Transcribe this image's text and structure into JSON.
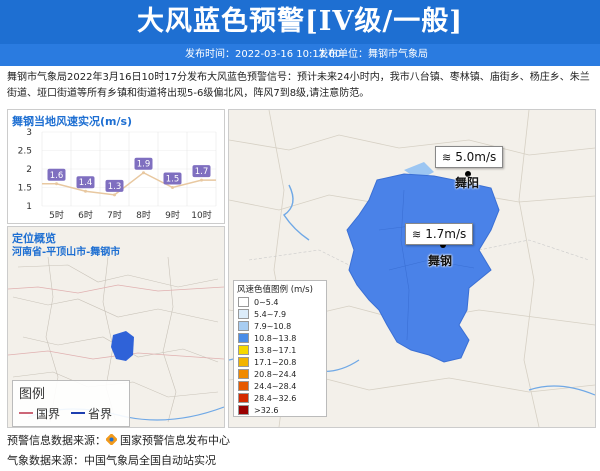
{
  "header": {
    "title": "大风蓝色预警[IV级/一般]",
    "publish_time": "发布时间：2022-03-16 10:17:00",
    "publish_unit": "发布单位：舞钢市气象局"
  },
  "description": "舞钢市气象局2022年3月16日10时17分发布大风蓝色预警信号：预计未来24小时内，我市八台镇、枣林镇、庙街乡、杨庄乡、朱兰街道、垭口街道等所有乡镇和街道将出现5-6级偏北风，阵风7到8级,请注意防范。",
  "wind_panel": {
    "title": "舞钢当地风速实况(m/s)",
    "chart_data": {
      "type": "line",
      "categories": [
        "5时",
        "6时",
        "7时",
        "8时",
        "9时",
        "10时"
      ],
      "values": [
        1.6,
        1.4,
        1.3,
        1.9,
        1.5,
        1.7
      ],
      "ylim": [
        1,
        3
      ],
      "yticks": [
        "3",
        "2.5",
        "2",
        "1.5",
        "1"
      ],
      "color": "#7f6fc0"
    }
  },
  "location_panel": {
    "title": "定位概览",
    "subtitle": "河南省-平顶山市-舞钢市",
    "legend": {
      "title": "图例",
      "items": [
        {
          "label": "国界",
          "color": "#cc6677"
        },
        {
          "label": "省界",
          "color": "#1e3fb0"
        }
      ]
    }
  },
  "main_map": {
    "wind_tags": [
      {
        "label": "5.0m/s",
        "icon": "wind-icon"
      },
      {
        "label": "1.7m/s",
        "icon": "wind-icon"
      }
    ],
    "cities": [
      "舞阳",
      "舞钢"
    ],
    "scale": {
      "title": "风速色值图例 (m/s)",
      "items": [
        {
          "label": "0~5.4",
          "color": "#ffffff"
        },
        {
          "label": "5.4~7.9",
          "color": "#dcecfa"
        },
        {
          "label": "7.9~10.8",
          "color": "#a8cdf2"
        },
        {
          "label": "10.8~13.8",
          "color": "#4a8de8"
        },
        {
          "label": "13.8~17.1",
          "color": "#f5d800"
        },
        {
          "label": "17.1~20.8",
          "color": "#f2b400"
        },
        {
          "label": "20.8~24.4",
          "color": "#f08a00"
        },
        {
          "label": "24.4~28.4",
          "color": "#e65a00"
        },
        {
          "label": "28.4~32.6",
          "color": "#d42a00"
        },
        {
          "label": ">32.6",
          "color": "#9a0000"
        }
      ]
    }
  },
  "footer": {
    "source1_label": "预警信息数据来源：",
    "source1_value": "国家预警信息发布中心",
    "source2": "气象数据来源：中国气象局全国自动站实况"
  }
}
